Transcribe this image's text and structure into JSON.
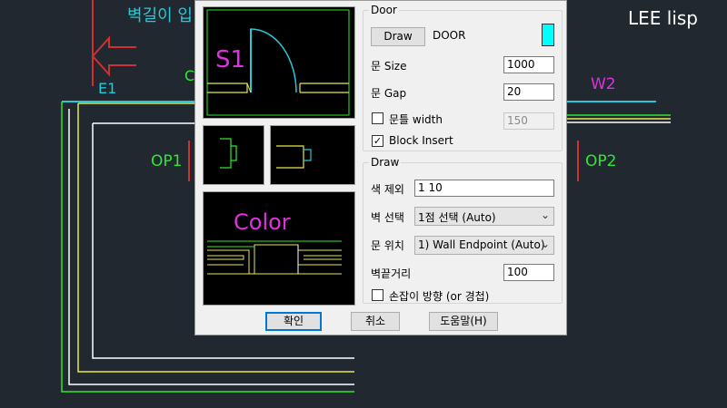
{
  "cad": {
    "top_label": "벽길이 입",
    "e1_label": "E1",
    "g_label": "C",
    "w2_label": "W2",
    "op1_label": "OP1",
    "op2_label": "OP2",
    "brand": "LEE lisp",
    "colors": {
      "background": "#212830",
      "cyan": "#27c8d8",
      "green": "#2ee82e",
      "yellow": "#e8e84a",
      "magenta": "#e030e0",
      "red": "#d03030",
      "white": "#ffffff"
    }
  },
  "previews": {
    "s1_label": "S1",
    "color_label": "Color"
  },
  "door": {
    "group_title": "Door",
    "draw_button": "Draw",
    "block_name": "DOOR",
    "swatch_color": "#00ffff",
    "size_label": "문 Size",
    "size_value": "1000",
    "gap_label": "문 Gap",
    "gap_value": "20",
    "frame_width_label": "문틀 width",
    "frame_width_checked": false,
    "frame_width_value": "150",
    "block_insert_label": "Block Insert",
    "block_insert_checked": true
  },
  "draw": {
    "group_title": "Draw",
    "exclude_color_label": "색 제외",
    "exclude_color_value": "1 10",
    "wall_select_label": "벽 선택",
    "wall_select_value": "1점 선택 (Auto)",
    "door_position_label": "문 위치",
    "door_position_value": "1) Wall Endpoint (Auto)",
    "wall_end_distance_label": "벽끝거리",
    "wall_end_distance_value": "100",
    "handle_direction_label": "손잡이 방향 (or 경첩)",
    "handle_direction_checked": false
  },
  "buttons": {
    "ok": "확인",
    "cancel": "취소",
    "help": "도움말(H)"
  }
}
